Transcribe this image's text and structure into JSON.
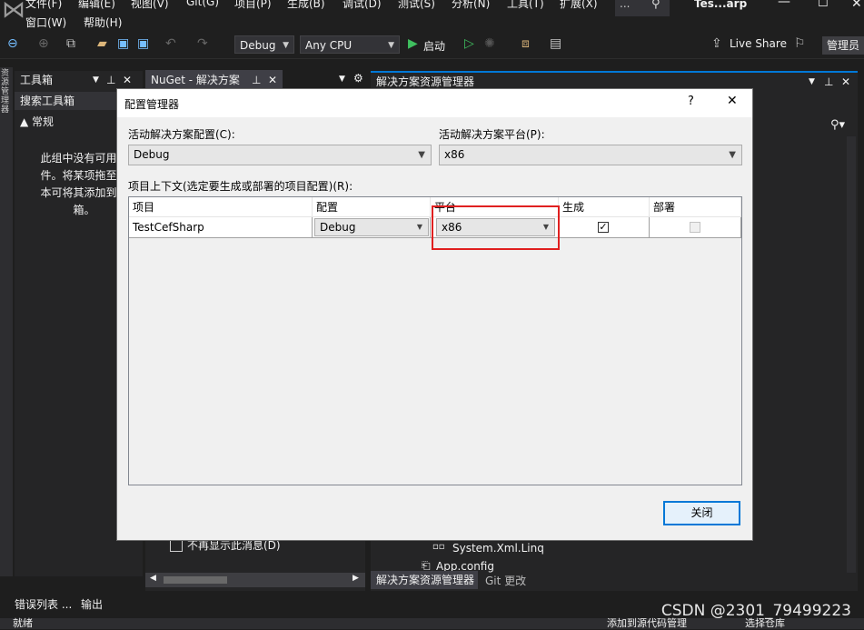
{
  "menu": {
    "file": "文件(F)",
    "edit": "编辑(E)",
    "view": "视图(V)",
    "git": "Git(G)",
    "project": "项目(P)",
    "build": "生成(B)",
    "debug": "调试(D)",
    "test": "测试(S)",
    "analyze": "分析(N)",
    "tools": "工具(T)",
    "extensions": "扩展(X)",
    "window": "窗口(W)",
    "help": "帮助(H)",
    "search_dots": "...",
    "solution_name": "Tes...arp"
  },
  "toolbar": {
    "config_value": "Debug",
    "platform_value": "Any CPU",
    "start_label": "启动",
    "live_share": "Live Share",
    "manage_label": "管理员"
  },
  "left_panel": {
    "toolbox_title": "工具箱",
    "search_toolbox": "搜索工具箱",
    "general_group": "▲ 常规",
    "empty_line1": "此组中没有可用的",
    "empty_line2": "件。将某项拖至此",
    "empty_line3": "本可将其添加到工",
    "empty_line4": "箱。",
    "vertical_tab": "资源管理器"
  },
  "nuget_tab": {
    "title": "NuGet - 解决方案",
    "dont_show": "不再显示此消息(D)"
  },
  "solution_explorer": {
    "title": "解决方案资源管理器",
    "item_xml_linq": "System.Xml.Linq",
    "item_app_config": "App.config",
    "tab_solution": "解决方案资源管理器",
    "tab_git": "Git 更改"
  },
  "bottom_tabs": {
    "errors": "错误列表 ...",
    "output": "输出",
    "status_left": "就绪",
    "status_add_src": "添加到源代码管理",
    "status_select_repo": "选择仓库"
  },
  "dialog": {
    "title": "配置管理器",
    "help_glyph": "?",
    "close_glyph": "✕",
    "active_config_label": "活动解决方案配置(C):",
    "active_config_value": "Debug",
    "active_platform_label": "活动解决方案平台(P):",
    "active_platform_value": "x86",
    "context_label": "项目上下文(选定要生成或部署的项目配置)(R):",
    "columns": [
      "项目",
      "配置",
      "平台",
      "生成",
      "部署"
    ],
    "rows": [
      {
        "project": "TestCefSharp",
        "config": "Debug",
        "platform": "x86",
        "build": true,
        "deploy": false
      }
    ],
    "close_button": "关闭"
  },
  "watermark": "CSDN @2301_79499223",
  "colors": {
    "accent": "#0078d7",
    "highlight_border": "#e02020",
    "vs_bg": "#1e1e1e"
  }
}
